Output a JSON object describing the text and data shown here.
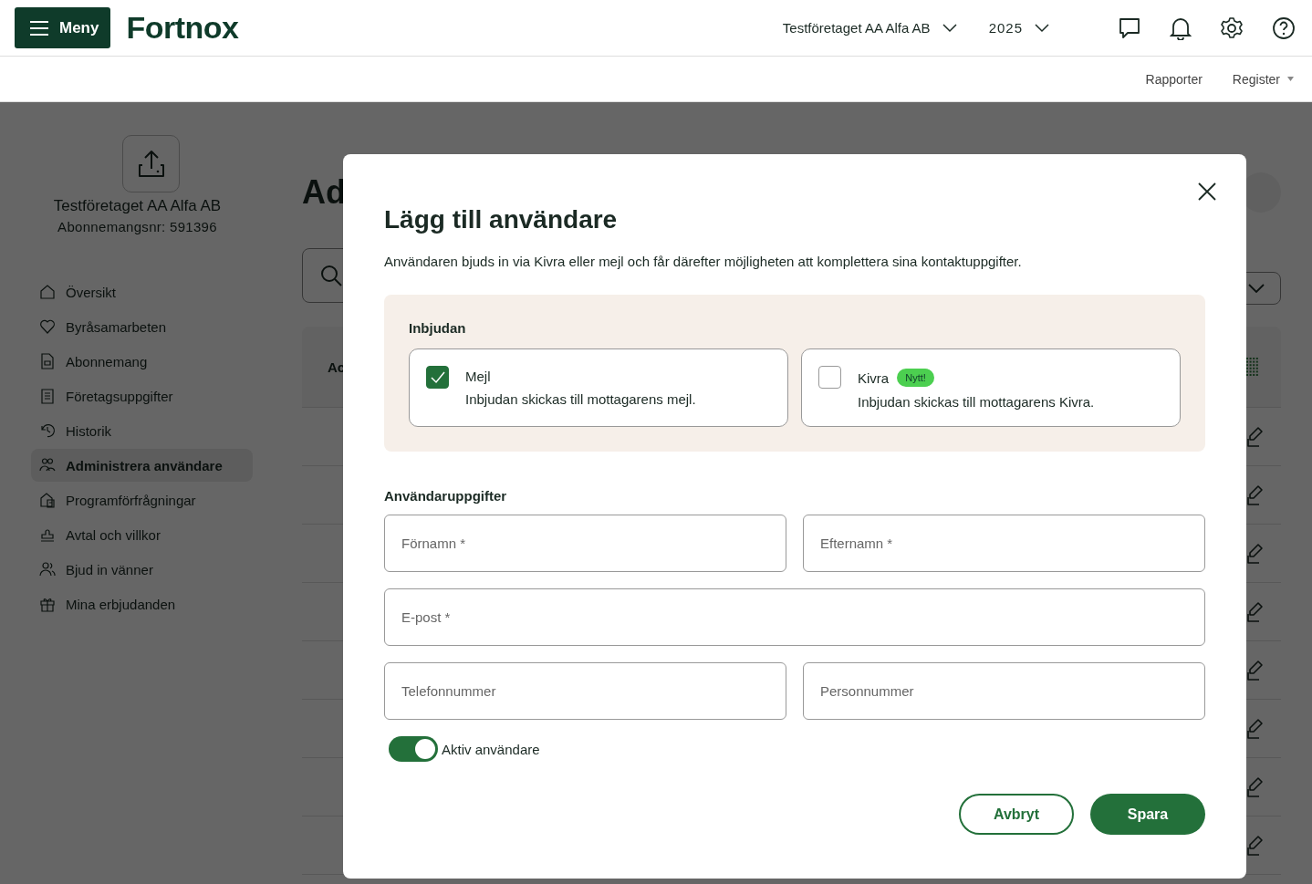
{
  "header": {
    "menu_button": "Meny",
    "logo": "Fortnox",
    "company_selector": "Testföretaget AA Alfa AB",
    "year_selector": "2025"
  },
  "subnav": [
    {
      "label": "Rapporter",
      "dropdown": false
    },
    {
      "label": "Register",
      "dropdown": true
    }
  ],
  "sidebar": {
    "company": "Testföretaget AA Alfa AB",
    "subscription": "Abonnemangsnr: 591396",
    "items": [
      {
        "label": "Översikt",
        "selected": false
      },
      {
        "label": "Byråsamarbeten",
        "selected": false
      },
      {
        "label": "Abonnemang",
        "selected": false
      },
      {
        "label": "Företagsuppgifter",
        "selected": false
      },
      {
        "label": "Historik",
        "selected": false
      },
      {
        "label": "Administrera användare",
        "selected": true
      },
      {
        "label": "Programförfrågningar",
        "selected": false
      },
      {
        "label": "Avtal och villkor",
        "selected": false
      },
      {
        "label": "Bjud in vänner",
        "selected": false
      },
      {
        "label": "Mina erbjudanden",
        "selected": false
      }
    ]
  },
  "main": {
    "title": "Ad",
    "column_1": "Ac"
  },
  "dialog": {
    "title": "Lägg till användare",
    "description": "Användaren bjuds in via Kivra eller mejl och får därefter möjligheten att komplettera sina kontaktuppgifter.",
    "invite": {
      "heading": "Inbjudan",
      "options": [
        {
          "label": "Mejl",
          "description": "Inbjudan skickas till mottagarens mejl.",
          "checked": true
        },
        {
          "label": "Kivra",
          "badge": "Nytt!",
          "description": "Inbjudan skickas till mottagarens Kivra.",
          "checked": false
        }
      ]
    },
    "user_details": {
      "heading": "Användaruppgifter",
      "fields": [
        {
          "placeholder": "Förnamn *"
        },
        {
          "placeholder": "Efternamn *"
        },
        {
          "placeholder": "E-post *"
        },
        {
          "placeholder": "Telefonnummer"
        },
        {
          "placeholder": "Personnummer"
        }
      ]
    },
    "active_toggle": {
      "label": "Aktiv användare",
      "on": true
    },
    "buttons": [
      {
        "label": "Avbryt",
        "kind": "secondary"
      },
      {
        "label": "Spara",
        "kind": "primary"
      }
    ]
  }
}
